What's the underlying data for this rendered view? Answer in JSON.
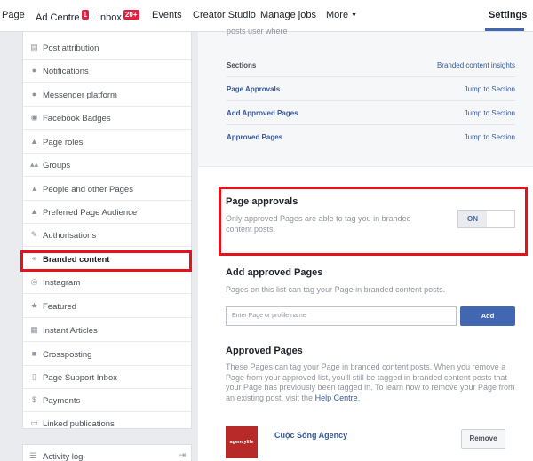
{
  "nav": {
    "page": "Page",
    "ad_centre": "Ad Centre",
    "ad_centre_badge": "1",
    "inbox": "Inbox",
    "inbox_badge": "20+",
    "events": "Events",
    "creator_studio": "Creator Studio",
    "manage_jobs": "Manage jobs",
    "more": "More",
    "settings": "Settings"
  },
  "sidebar": {
    "items": [
      {
        "label": "Post attribution",
        "icon": "post-attribution-icon"
      },
      {
        "label": "Notifications",
        "icon": "globe-icon"
      },
      {
        "label": "Messenger platform",
        "icon": "messenger-icon"
      },
      {
        "label": "Facebook Badges",
        "icon": "badge-icon"
      },
      {
        "label": "Page roles",
        "icon": "person-icon"
      },
      {
        "label": "Groups",
        "icon": "groups-icon"
      },
      {
        "label": "People and other Pages",
        "icon": "people-icon"
      },
      {
        "label": "Preferred Page Audience",
        "icon": "audience-icon"
      },
      {
        "label": "Authorisations",
        "icon": "wrench-icon"
      },
      {
        "label": "Branded content",
        "icon": "handshake-icon"
      },
      {
        "label": "Instagram",
        "icon": "instagram-icon"
      },
      {
        "label": "Featured",
        "icon": "star-icon"
      },
      {
        "label": "Instant Articles",
        "icon": "article-icon"
      },
      {
        "label": "Crossposting",
        "icon": "video-icon"
      },
      {
        "label": "Page Support Inbox",
        "icon": "inbox-icon"
      },
      {
        "label": "Payments",
        "icon": "dollar-icon"
      },
      {
        "label": "Linked publications",
        "icon": "document-icon"
      }
    ],
    "activity_log": "Activity log"
  },
  "sections": {
    "cut_text": "posts user where",
    "header_left": "Sections",
    "header_right": "Branded content insights",
    "rows": [
      {
        "label": "Page Approvals",
        "action": "Jump to Section"
      },
      {
        "label": "Add Approved Pages",
        "action": "Jump to Section"
      },
      {
        "label": "Approved Pages",
        "action": "Jump to Section"
      }
    ]
  },
  "page_approvals": {
    "title": "Page approvals",
    "desc": "Only approved Pages are able to tag you in branded content posts.",
    "toggle": "ON"
  },
  "add_approved": {
    "title": "Add approved Pages",
    "desc": "Pages on this list can tag your Page in branded content posts.",
    "placeholder": "Enter Page or profile name",
    "button": "Add"
  },
  "approved_pages": {
    "title": "Approved Pages",
    "desc": "These Pages can tag your Page in branded content posts. When you remove a Page from your approved list, you'll still be tagged in branded content posts that your Page has previously been tagged in. To learn how to remove your Page from an existing post, visit the",
    "help_link": "Help Centre",
    "help_suffix": ".",
    "logo_text": "agencylife",
    "page_name": "Cuộc Sống Agency",
    "remove": "Remove"
  },
  "colors": {
    "accent": "#4267b2",
    "link": "#365899",
    "highlight": "#e4121d"
  }
}
